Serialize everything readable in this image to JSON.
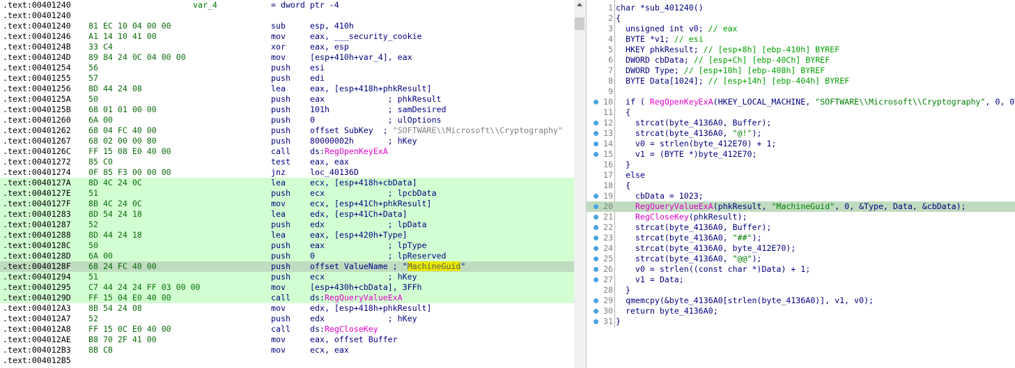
{
  "disasm": {
    "lines": [
      {
        "addr": ".text:00401240",
        "bytes": "",
        "label": "var_4",
        "mn": "= dword ptr -4",
        "ops": [],
        "hl": ""
      },
      {
        "addr": ".text:00401240",
        "bytes": "",
        "label": "",
        "mn": "",
        "ops": [],
        "hl": ""
      },
      {
        "addr": ".text:00401240",
        "bytes": "81 EC 10 04 00 00",
        "label": "",
        "mn": "sub",
        "ops": [
          {
            "t": "esp, 410h",
            "c": ""
          }
        ],
        "hl": ""
      },
      {
        "addr": ".text:00401246",
        "bytes": "A1 14 10 41 00",
        "label": "",
        "mn": "mov",
        "ops": [
          {
            "t": "eax, ___security_cookie",
            "c": ""
          }
        ],
        "hl": ""
      },
      {
        "addr": ".text:0040124B",
        "bytes": "33 C4",
        "label": "",
        "mn": "xor",
        "ops": [
          {
            "t": "eax, esp",
            "c": ""
          }
        ],
        "hl": ""
      },
      {
        "addr": ".text:0040124D",
        "bytes": "89 84 24 0C 04 00 00",
        "label": "",
        "mn": "mov",
        "ops": [
          {
            "t": "[esp+410h+var_4], eax",
            "c": ""
          }
        ],
        "hl": ""
      },
      {
        "addr": ".text:00401254",
        "bytes": "56",
        "label": "",
        "mn": "push",
        "ops": [
          {
            "t": "esi",
            "c": ""
          }
        ],
        "hl": ""
      },
      {
        "addr": ".text:00401255",
        "bytes": "57",
        "label": "",
        "mn": "push",
        "ops": [
          {
            "t": "edi",
            "c": ""
          }
        ],
        "hl": ""
      },
      {
        "addr": ".text:00401256",
        "bytes": "8D 44 24 08",
        "label": "",
        "mn": "lea",
        "ops": [
          {
            "t": "eax, [esp+418h+phkResult]",
            "c": ""
          }
        ],
        "hl": ""
      },
      {
        "addr": ".text:0040125A",
        "bytes": "50",
        "label": "",
        "mn": "push",
        "ops": [
          {
            "t": "eax             ; phkResult",
            "c": ""
          }
        ],
        "hl": ""
      },
      {
        "addr": ".text:0040125B",
        "bytes": "68 01 01 00 00",
        "label": "",
        "mn": "push",
        "ops": [
          {
            "t": "101h            ; samDesired",
            "c": ""
          }
        ],
        "hl": ""
      },
      {
        "addr": ".text:00401260",
        "bytes": "6A 00",
        "label": "",
        "mn": "push",
        "ops": [
          {
            "t": "0               ; ulOptions",
            "c": ""
          }
        ],
        "hl": ""
      },
      {
        "addr": ".text:00401262",
        "bytes": "68 04 FC 40 00",
        "label": "",
        "mn": "push",
        "ops": [
          {
            "t": "offset SubKey  ; ",
            "c": ""
          },
          {
            "t": "\"SOFTWARE\\\\Microsoft\\\\Cryptography\"",
            "c": "str"
          }
        ],
        "hl": ""
      },
      {
        "addr": ".text:00401267",
        "bytes": "68 02 00 00 80",
        "label": "",
        "mn": "push",
        "ops": [
          {
            "t": "80000002h       ; hKey",
            "c": ""
          }
        ],
        "hl": ""
      },
      {
        "addr": ".text:0040126C",
        "bytes": "FF 15 08 E0 40 00",
        "label": "",
        "mn": "call",
        "ops": [
          {
            "t": "ds:",
            "c": ""
          },
          {
            "t": "RegOpenKeyExA",
            "c": "imp"
          }
        ],
        "hl": ""
      },
      {
        "addr": ".text:00401272",
        "bytes": "85 C0",
        "label": "",
        "mn": "test",
        "ops": [
          {
            "t": "eax, eax",
            "c": ""
          }
        ],
        "hl": ""
      },
      {
        "addr": ".text:00401274",
        "bytes": "0F 85 F3 00 00 00",
        "label": "",
        "mn": "jnz",
        "ops": [
          {
            "t": "loc_40136D",
            "c": ""
          }
        ],
        "hl": ""
      },
      {
        "addr": ".text:0040127A",
        "bytes": "8D 4C 24 0C",
        "label": "",
        "mn": "lea",
        "ops": [
          {
            "t": "ecx, [esp+418h+cbData]",
            "c": ""
          }
        ],
        "hl": "hl"
      },
      {
        "addr": ".text:0040127E",
        "bytes": "51",
        "label": "",
        "mn": "push",
        "ops": [
          {
            "t": "ecx             ; lpcbData",
            "c": ""
          }
        ],
        "hl": "hl"
      },
      {
        "addr": ".text:0040127F",
        "bytes": "8B 4C 24 0C",
        "label": "",
        "mn": "mov",
        "ops": [
          {
            "t": "ecx, [esp+41Ch+phkResult]",
            "c": ""
          }
        ],
        "hl": "hl"
      },
      {
        "addr": ".text:00401283",
        "bytes": "8D 54 24 18",
        "label": "",
        "mn": "lea",
        "ops": [
          {
            "t": "edx, [esp+41Ch+Data]",
            "c": ""
          }
        ],
        "hl": "hl"
      },
      {
        "addr": ".text:00401287",
        "bytes": "52",
        "label": "",
        "mn": "push",
        "ops": [
          {
            "t": "edx             ; lpData",
            "c": ""
          }
        ],
        "hl": "hl"
      },
      {
        "addr": ".text:00401288",
        "bytes": "8D 44 24 18",
        "label": "",
        "mn": "lea",
        "ops": [
          {
            "t": "eax, [esp+420h+Type]",
            "c": ""
          }
        ],
        "hl": "hl"
      },
      {
        "addr": ".text:0040128C",
        "bytes": "50",
        "label": "",
        "mn": "push",
        "ops": [
          {
            "t": "eax             ; lpType",
            "c": ""
          }
        ],
        "hl": "hl"
      },
      {
        "addr": ".text:0040128D",
        "bytes": "6A 00",
        "label": "",
        "mn": "push",
        "ops": [
          {
            "t": "0               ; lpReserved",
            "c": ""
          }
        ],
        "hl": "hl"
      },
      {
        "addr": ".text:0040128F",
        "bytes": "68 24 FC 40 00",
        "label": "",
        "mn": "push",
        "ops": [
          {
            "t": "offset ValueName ; \"",
            "c": ""
          },
          {
            "t": "MachineGuid",
            "c": "sel"
          },
          {
            "t": "\"",
            "c": ""
          }
        ],
        "hl": "cur"
      },
      {
        "addr": ".text:00401294",
        "bytes": "51",
        "label": "",
        "mn": "push",
        "ops": [
          {
            "t": "ecx             ; hKey",
            "c": ""
          }
        ],
        "hl": "hl"
      },
      {
        "addr": ".text:00401295",
        "bytes": "C7 44 24 24 FF 03 00 00",
        "label": "",
        "mn": "mov",
        "ops": [
          {
            "t": "[esp+430h+cbData], 3FFh",
            "c": ""
          }
        ],
        "hl": "hl"
      },
      {
        "addr": ".text:0040129D",
        "bytes": "FF 15 04 E0 40 00",
        "label": "",
        "mn": "call",
        "ops": [
          {
            "t": "ds:",
            "c": ""
          },
          {
            "t": "RegQueryValueExA",
            "c": "imp"
          }
        ],
        "hl": "hl"
      },
      {
        "addr": ".text:004012A3",
        "bytes": "8B 54 24 08",
        "label": "",
        "mn": "mov",
        "ops": [
          {
            "t": "edx, [esp+418h+phkResult]",
            "c": ""
          }
        ],
        "hl": ""
      },
      {
        "addr": ".text:004012A7",
        "bytes": "52",
        "label": "",
        "mn": "push",
        "ops": [
          {
            "t": "edx             ; hKey",
            "c": ""
          }
        ],
        "hl": ""
      },
      {
        "addr": ".text:004012A8",
        "bytes": "FF 15 0C E0 40 00",
        "label": "",
        "mn": "call",
        "ops": [
          {
            "t": "ds:",
            "c": ""
          },
          {
            "t": "RegCloseKey",
            "c": "imp"
          }
        ],
        "hl": ""
      },
      {
        "addr": ".text:004012AE",
        "bytes": "B8 70 2F 41 00",
        "label": "",
        "mn": "mov",
        "ops": [
          {
            "t": "eax, offset Buffer",
            "c": ""
          }
        ],
        "hl": ""
      },
      {
        "addr": ".text:004012B3",
        "bytes": "8B C8",
        "label": "",
        "mn": "mov",
        "ops": [
          {
            "t": "ecx, eax",
            "c": ""
          }
        ],
        "hl": ""
      },
      {
        "addr": ".text:004012B5",
        "bytes": "",
        "label": "",
        "mn": "",
        "ops": [],
        "hl": ""
      }
    ]
  },
  "pseudocode": {
    "lines": [
      {
        "n": "1",
        "bp": false,
        "hl": false,
        "seg": [
          {
            "t": "char *sub_401240()",
            "c": ""
          }
        ]
      },
      {
        "n": "2",
        "bp": false,
        "hl": false,
        "seg": [
          {
            "t": "{",
            "c": ""
          }
        ]
      },
      {
        "n": "3",
        "bp": false,
        "hl": false,
        "seg": [
          {
            "t": "  unsigned int v0; ",
            "c": ""
          },
          {
            "t": "// eax",
            "c": "cm"
          }
        ]
      },
      {
        "n": "4",
        "bp": false,
        "hl": false,
        "seg": [
          {
            "t": "  BYTE *v1; ",
            "c": ""
          },
          {
            "t": "// esi",
            "c": "cm"
          }
        ]
      },
      {
        "n": "5",
        "bp": false,
        "hl": false,
        "seg": [
          {
            "t": "  HKEY phkResult; ",
            "c": ""
          },
          {
            "t": "// [esp+8h] [ebp-410h] BYREF",
            "c": "cm"
          }
        ]
      },
      {
        "n": "6",
        "bp": false,
        "hl": false,
        "seg": [
          {
            "t": "  DWORD cbData; ",
            "c": ""
          },
          {
            "t": "// [esp+Ch] [ebp-40Ch] BYREF",
            "c": "cm"
          }
        ]
      },
      {
        "n": "7",
        "bp": false,
        "hl": false,
        "seg": [
          {
            "t": "  DWORD Type; ",
            "c": ""
          },
          {
            "t": "// [esp+10h] [ebp-408h] BYREF",
            "c": "cm"
          }
        ]
      },
      {
        "n": "8",
        "bp": false,
        "hl": false,
        "seg": [
          {
            "t": "  BYTE Data[1024]; ",
            "c": ""
          },
          {
            "t": "// [esp+14h] [ebp-404h] BYREF",
            "c": "cm"
          }
        ]
      },
      {
        "n": "9",
        "bp": false,
        "hl": false,
        "seg": [
          {
            "t": "",
            "c": ""
          }
        ]
      },
      {
        "n": "10",
        "bp": true,
        "hl": false,
        "seg": [
          {
            "t": "  if ( ",
            "c": ""
          },
          {
            "t": "RegOpenKeyExA",
            "c": "fn"
          },
          {
            "t": "(HKEY_LOCAL_MACHINE, ",
            "c": ""
          },
          {
            "t": "\"SOFTWARE\\\\Microsoft\\\\Cryptography\"",
            "c": "s"
          },
          {
            "t": ", 0, 0",
            "c": ""
          }
        ]
      },
      {
        "n": "11",
        "bp": false,
        "hl": false,
        "seg": [
          {
            "t": "  {",
            "c": ""
          }
        ]
      },
      {
        "n": "12",
        "bp": true,
        "hl": false,
        "seg": [
          {
            "t": "    strcat(byte_4136A0, Buffer);",
            "c": ""
          }
        ]
      },
      {
        "n": "13",
        "bp": true,
        "hl": false,
        "seg": [
          {
            "t": "    strcat(byte_4136A0, ",
            "c": ""
          },
          {
            "t": "\"@!\"",
            "c": "s"
          },
          {
            "t": ");",
            "c": ""
          }
        ]
      },
      {
        "n": "14",
        "bp": true,
        "hl": false,
        "seg": [
          {
            "t": "    v0 = strlen(byte_412E70) + 1;",
            "c": ""
          }
        ]
      },
      {
        "n": "15",
        "bp": true,
        "hl": false,
        "seg": [
          {
            "t": "    v1 = (BYTE *)byte_412E70;",
            "c": ""
          }
        ]
      },
      {
        "n": "16",
        "bp": false,
        "hl": false,
        "seg": [
          {
            "t": "  }",
            "c": ""
          }
        ]
      },
      {
        "n": "17",
        "bp": false,
        "hl": false,
        "seg": [
          {
            "t": "  else",
            "c": ""
          }
        ]
      },
      {
        "n": "18",
        "bp": false,
        "hl": false,
        "seg": [
          {
            "t": "  {",
            "c": ""
          }
        ]
      },
      {
        "n": "19",
        "bp": true,
        "hl": false,
        "seg": [
          {
            "t": "    cbData = 1023;",
            "c": ""
          }
        ]
      },
      {
        "n": "20",
        "bp": true,
        "hl": true,
        "seg": [
          {
            "t": "    ",
            "c": ""
          },
          {
            "t": "RegQueryValueExA",
            "c": "fn"
          },
          {
            "t": "(phkResult, ",
            "c": ""
          },
          {
            "t": "\"MachineGuid\"",
            "c": "s"
          },
          {
            "t": ", 0, &Type, Data, &cbData);",
            "c": ""
          }
        ]
      },
      {
        "n": "21",
        "bp": true,
        "hl": false,
        "seg": [
          {
            "t": "    ",
            "c": ""
          },
          {
            "t": "RegCloseKey",
            "c": "fn"
          },
          {
            "t": "(phkResult);",
            "c": ""
          }
        ]
      },
      {
        "n": "22",
        "bp": true,
        "hl": false,
        "seg": [
          {
            "t": "    strcat(byte_4136A0, Buffer);",
            "c": ""
          }
        ]
      },
      {
        "n": "23",
        "bp": true,
        "hl": false,
        "seg": [
          {
            "t": "    strcat(byte_4136A0, ",
            "c": ""
          },
          {
            "t": "\"##\"",
            "c": "s"
          },
          {
            "t": ");",
            "c": ""
          }
        ]
      },
      {
        "n": "24",
        "bp": true,
        "hl": false,
        "seg": [
          {
            "t": "    strcat(byte_4136A0, byte_412E70);",
            "c": ""
          }
        ]
      },
      {
        "n": "25",
        "bp": true,
        "hl": false,
        "seg": [
          {
            "t": "    strcat(byte_4136A0, ",
            "c": ""
          },
          {
            "t": "\"@@\"",
            "c": "s"
          },
          {
            "t": ");",
            "c": ""
          }
        ]
      },
      {
        "n": "26",
        "bp": true,
        "hl": false,
        "seg": [
          {
            "t": "    v0 = strlen((const char *)Data) + 1;",
            "c": ""
          }
        ]
      },
      {
        "n": "27",
        "bp": true,
        "hl": false,
        "seg": [
          {
            "t": "    v1 = Data;",
            "c": ""
          }
        ]
      },
      {
        "n": "28",
        "bp": false,
        "hl": false,
        "seg": [
          {
            "t": "  }",
            "c": ""
          }
        ]
      },
      {
        "n": "29",
        "bp": true,
        "hl": false,
        "seg": [
          {
            "t": "  qmemcpy(&byte_4136A0[strlen(byte_4136A0)], v1, v0);",
            "c": ""
          }
        ]
      },
      {
        "n": "30",
        "bp": true,
        "hl": false,
        "seg": [
          {
            "t": "  return byte_4136A0;",
            "c": ""
          }
        ]
      },
      {
        "n": "31",
        "bp": true,
        "hl": false,
        "seg": [
          {
            "t": "}",
            "c": ""
          }
        ]
      }
    ]
  }
}
